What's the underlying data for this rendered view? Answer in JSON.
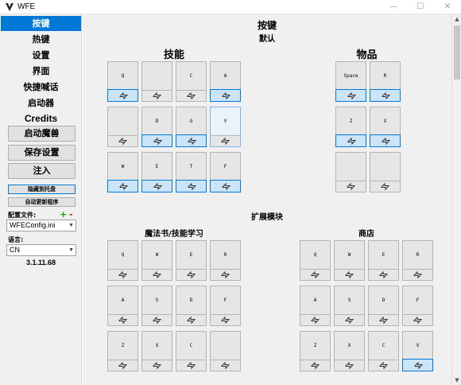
{
  "window": {
    "title": "WFE",
    "minimize": "—",
    "maximize": "☐",
    "close": "✕"
  },
  "sidebar": {
    "nav": [
      {
        "label": "按键",
        "active": true
      },
      {
        "label": "热键"
      },
      {
        "label": "设置"
      },
      {
        "label": "界面"
      },
      {
        "label": "快捷喊话"
      },
      {
        "label": "启动器"
      },
      {
        "label": "Credits"
      }
    ],
    "launch_button": "启动魔兽",
    "save_button": "保存设置",
    "inject_button": "注入",
    "hide_tray_button": "隐藏到托盘",
    "auto_update_button": "自动更新程序",
    "config_label": "配置文件:",
    "config_plus": "+",
    "config_minus": "-",
    "config_value": "WFEConfig.ini",
    "lang_label": "语言:",
    "lang_value": "CN",
    "version": "3.1.11.68"
  },
  "main": {
    "title": "按键",
    "default_header": "默认",
    "skills_header": "技能",
    "items_header": "物品",
    "skills": [
      {
        "key": "Q",
        "on": true
      },
      {
        "key": "",
        "on": false
      },
      {
        "key": "C",
        "on": false
      },
      {
        "key": "A",
        "on": true
      },
      {
        "key": "",
        "on": false
      },
      {
        "key": "D",
        "on": true
      },
      {
        "key": "G",
        "on": true
      },
      {
        "key": "V",
        "on": false,
        "selected": true
      },
      {
        "key": "W",
        "on": true
      },
      {
        "key": "E",
        "on": true
      },
      {
        "key": "T",
        "on": true
      },
      {
        "key": "F",
        "on": true
      }
    ],
    "items": [
      {
        "key": "Space",
        "on": true
      },
      {
        "key": "R",
        "on": true
      },
      {
        "key": "Z",
        "on": true
      },
      {
        "key": "X",
        "on": true
      },
      {
        "key": "",
        "on": false
      },
      {
        "key": "",
        "on": false
      }
    ],
    "extended_header": "扩展模块",
    "spellbook_header": "魔法书/技能学习",
    "shop_header": "商店",
    "spellbook": [
      {
        "key": "Q",
        "on": false
      },
      {
        "key": "W",
        "on": false
      },
      {
        "key": "E",
        "on": false
      },
      {
        "key": "R",
        "on": false
      },
      {
        "key": "A",
        "on": false
      },
      {
        "key": "S",
        "on": false
      },
      {
        "key": "D",
        "on": false
      },
      {
        "key": "F",
        "on": false
      },
      {
        "key": "Z",
        "on": false
      },
      {
        "key": "X",
        "on": false
      },
      {
        "key": "C",
        "on": false
      },
      {
        "key": "",
        "on": false
      }
    ],
    "shop": [
      {
        "key": "Q",
        "on": false
      },
      {
        "key": "W",
        "on": false
      },
      {
        "key": "E",
        "on": false
      },
      {
        "key": "R",
        "on": false
      },
      {
        "key": "A",
        "on": false
      },
      {
        "key": "S",
        "on": false
      },
      {
        "key": "D",
        "on": false
      },
      {
        "key": "F",
        "on": false
      },
      {
        "key": "Z",
        "on": false
      },
      {
        "key": "X",
        "on": false
      },
      {
        "key": "C",
        "on": false
      },
      {
        "key": "V",
        "on": true
      }
    ]
  },
  "icons": {
    "toggle": "autocast-toggle-icon",
    "app": "wfe-logo-icon"
  },
  "colors": {
    "accent": "#0078d7",
    "toggle_on": "#cce4f7",
    "plus": "#1a9e1a",
    "minus": "#d01010"
  }
}
